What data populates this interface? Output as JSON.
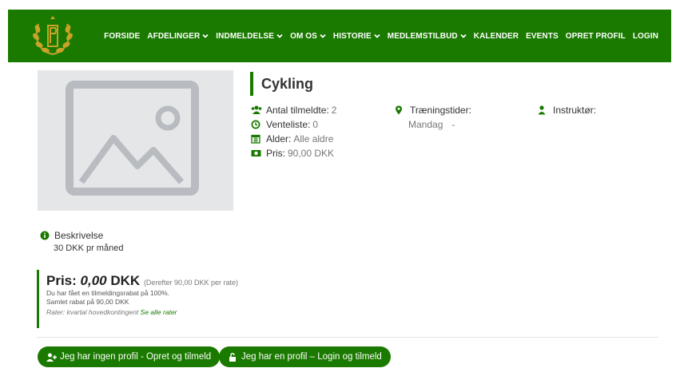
{
  "nav": {
    "items": [
      {
        "label": "FORSIDE",
        "dropdown": false
      },
      {
        "label": "AFDELINGER",
        "dropdown": true
      },
      {
        "label": "INDMELDELSE",
        "dropdown": true
      },
      {
        "label": "OM OS",
        "dropdown": true
      },
      {
        "label": "HISTORIE",
        "dropdown": true
      },
      {
        "label": "MEDLEMSTILBUD",
        "dropdown": true
      },
      {
        "label": "KALENDER",
        "dropdown": false
      },
      {
        "label": "EVENTS",
        "dropdown": false
      },
      {
        "label": "OPRET PROFIL",
        "dropdown": false
      },
      {
        "label": "LOGIN",
        "dropdown": false
      }
    ]
  },
  "activity": {
    "title": "Cykling",
    "enrolled_label": "Antal tilmeldte:",
    "enrolled_value": "2",
    "waitlist_label": "Venteliste:",
    "waitlist_value": "0",
    "age_label": "Alder:",
    "age_value": "Alle aldre",
    "price_label": "Pris:",
    "price_value": "90,00 DKK",
    "training_label": "Træningstider:",
    "training_day": "Mandag",
    "training_time": "-",
    "instructor_label": "Instruktør:"
  },
  "description": {
    "heading": "Beskrivelse",
    "text": "30 DKK pr måned"
  },
  "pricing": {
    "label": "Pris:",
    "amount": "0,00",
    "currency": "DKK",
    "after": "(Derefter 90,00 DKK per rate)",
    "discount_line": "Du har fået en tilmeldingsrabat på 100%.",
    "total_discount": "Samlet rabat på 90,00 DKK",
    "rates_label": "Rater: kvartal hovedkontingent",
    "rates_link": "Se alle rater"
  },
  "buttons": {
    "no_profile": "Jeg har ingen profil - Opret og tilmeld",
    "has_profile": "Jeg har en profil – Login og tilmeld"
  },
  "colors": {
    "brand_green": "#1a7a00",
    "logo_gold": "#c9a227"
  }
}
